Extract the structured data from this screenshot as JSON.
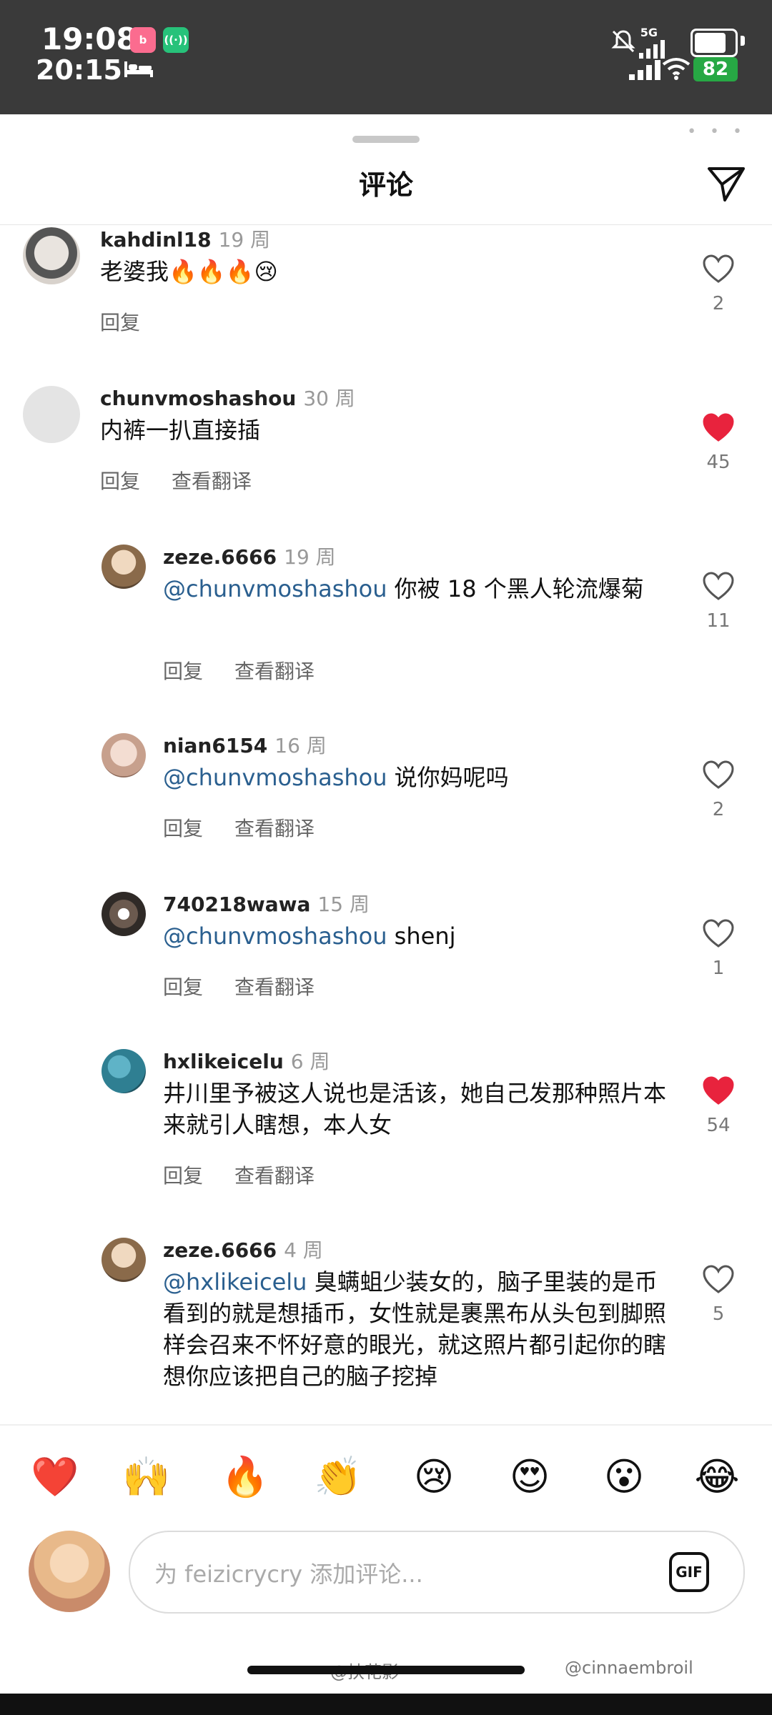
{
  "status": {
    "time_primary": "19:08",
    "time_secondary": "20:15",
    "network": "5G",
    "battery": "82",
    "battery_level": 0.82
  },
  "header": {
    "title": "评论"
  },
  "comments": [
    {
      "username": "kahdinl18",
      "age": "19 周",
      "text": "老婆我🔥🔥🔥😢",
      "actions": [
        "回复"
      ],
      "likes": "2",
      "liked": false
    },
    {
      "username": "chunvmoshashou",
      "age": "30 周",
      "text": "内裤一扒直接插",
      "actions": [
        "回复",
        "查看翻译"
      ],
      "likes": "45",
      "liked": true
    },
    {
      "username": "zeze.6666",
      "age": "19 周",
      "mention": "@chunvmoshashou",
      "text": " 你被 18 个黑人轮流爆菊",
      "actions": [
        "回复",
        "查看翻译"
      ],
      "likes": "11",
      "liked": false
    },
    {
      "username": "nian6154",
      "age": "16 周",
      "mention": "@chunvmoshashou",
      "text": " 说你妈呢吗",
      "actions": [
        "回复",
        "查看翻译"
      ],
      "likes": "2",
      "liked": false
    },
    {
      "username": "740218wawa",
      "age": "15 周",
      "mention": "@chunvmoshashou",
      "text": " shenj",
      "actions": [
        "回复",
        "查看翻译"
      ],
      "likes": "1",
      "liked": false
    },
    {
      "username": "hxlikeicelu",
      "age": "6 周",
      "text": "井川里予被这人说也是活该，她自己发那种照片本来就引人瞎想，本人女",
      "actions": [
        "回复",
        "查看翻译"
      ],
      "likes": "54",
      "liked": true
    },
    {
      "username": "zeze.6666",
      "age": "4 周",
      "mention": "@hxlikeicelu",
      "text": " 臭螨蛆少装女的，脑子里装的是币看到的就是想插币，女性就是裹黑布从头包到脚照样会召来不怀好意的眼光，就这照片都引起你的瞎想你应该把自己的脑子挖掉",
      "actions": [],
      "likes": "5",
      "liked": false
    }
  ],
  "emoji_bar": [
    "❤️",
    "🙌",
    "🔥",
    "👏",
    "😢",
    "😍",
    "😮",
    "😂"
  ],
  "compose": {
    "placeholder": "为 feizicrycry 添加评论...",
    "gif_label": "GIF"
  },
  "watermarks": {
    "left": "@扶花影",
    "right": "@cinnaembroil"
  }
}
